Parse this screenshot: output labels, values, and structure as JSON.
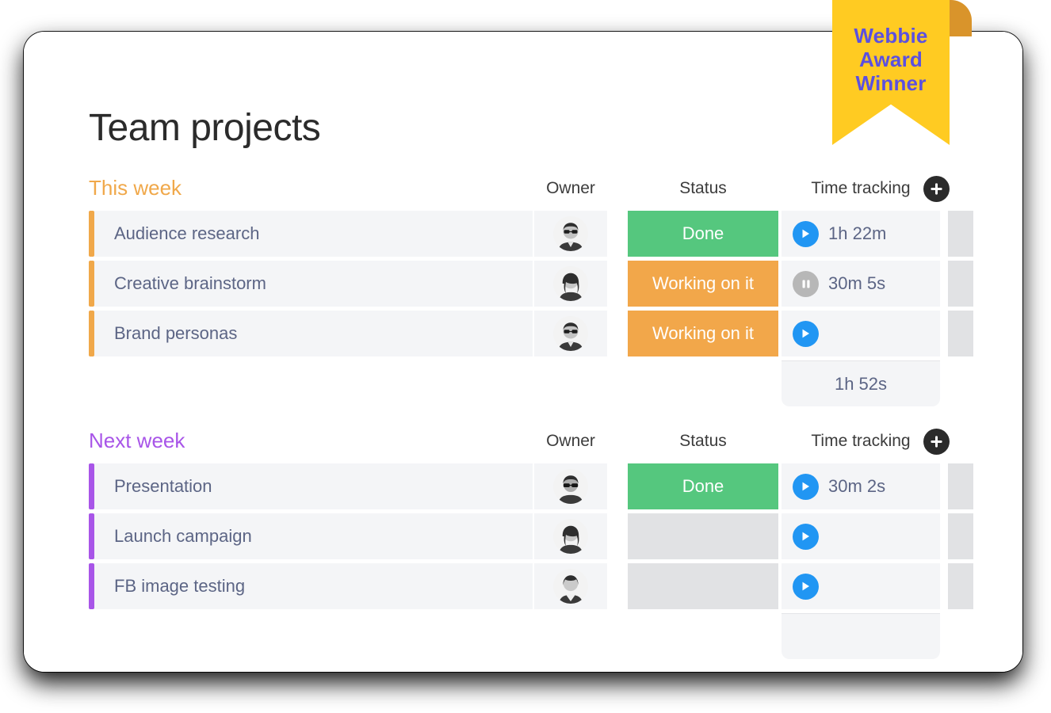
{
  "ribbon": {
    "line1": "Webbie",
    "line2": "Award",
    "line3": "Winner",
    "color": "#ffcb22",
    "text_color": "#5b50e0"
  },
  "page": {
    "title": "Team projects"
  },
  "columns": {
    "owner": "Owner",
    "status": "Status",
    "time_tracking": "Time tracking",
    "add_icon": "plus-circle-icon"
  },
  "colors": {
    "this_week": "#f0a84a",
    "next_week": "#a855e8",
    "status_done": "#55c77e",
    "status_working": "#f2a74a",
    "status_empty": "#e1e2e4",
    "play_button": "#2196f3",
    "pause_button": "#b7b7b7",
    "row_background": "#f4f5f7",
    "task_text": "#5c6585"
  },
  "groups": [
    {
      "title": "This week",
      "color": "#f0a84a",
      "rows": [
        {
          "name": "Audience research",
          "owner_avatar": "avatar-man-suit-glasses",
          "status": "Done",
          "status_color": "#55c77e",
          "timer_state": "play",
          "time": "1h 22m"
        },
        {
          "name": "Creative brainstorm",
          "owner_avatar": "avatar-woman-long-hair",
          "status": "Working on it",
          "status_color": "#f2a74a",
          "timer_state": "pause",
          "time": "30m 5s"
        },
        {
          "name": "Brand personas",
          "owner_avatar": "avatar-man-suit-glasses",
          "status": "Working on it",
          "status_color": "#f2a74a",
          "timer_state": "play",
          "time": ""
        }
      ],
      "summary": "1h 52s"
    },
    {
      "title": "Next week",
      "color": "#a855e8",
      "rows": [
        {
          "name": "Presentation",
          "owner_avatar": "avatar-person-sunglasses-curly",
          "status": "Done",
          "status_color": "#55c77e",
          "timer_state": "play",
          "time": "30m 2s"
        },
        {
          "name": "Launch campaign",
          "owner_avatar": "avatar-woman-long-hair",
          "status": "",
          "status_color": "#e1e2e4",
          "timer_state": "play",
          "time": ""
        },
        {
          "name": "FB image testing",
          "owner_avatar": "avatar-woman-blazer",
          "status": "",
          "status_color": "#e1e2e4",
          "timer_state": "play",
          "time": ""
        }
      ],
      "summary": ""
    }
  ]
}
